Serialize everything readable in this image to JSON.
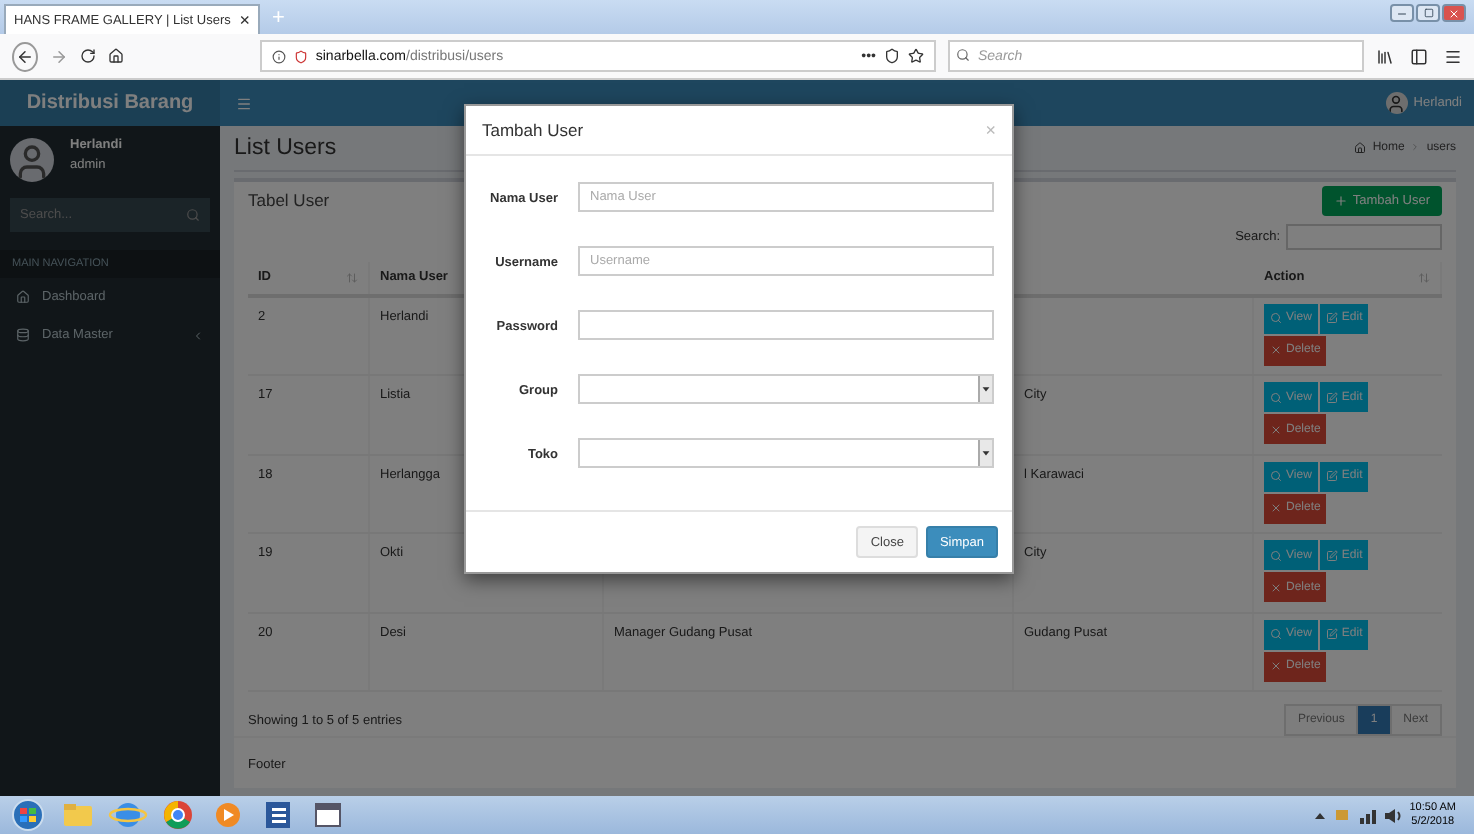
{
  "browser": {
    "tab": {
      "title": "HANS FRAME GALLERY | List Users",
      "close": "×"
    },
    "new_tab": "+",
    "url_host": "sinarbella.com",
    "url_path": "/distribusi/users",
    "page_actions": "•••",
    "search": {
      "placeholder": "Search"
    }
  },
  "header": {
    "brand": "Distribusi Barang",
    "user": "Herlandi"
  },
  "sidebar": {
    "user": {
      "name": "Herlandi",
      "role": "admin"
    },
    "search": {
      "placeholder": "Search..."
    },
    "section": "MAIN NAVIGATION",
    "items": [
      {
        "label": "Dashboard",
        "kind": "home",
        "expandable": false
      },
      {
        "label": "Data Master",
        "kind": "database",
        "expandable": true
      }
    ]
  },
  "content": {
    "title": "List Users",
    "breadcrumb": [
      "Home",
      "users"
    ],
    "box_title": "Tabel User",
    "add_button": "Tambah User",
    "search_label": "Search:",
    "columns": [
      "ID",
      "Nama User",
      "Action"
    ],
    "rows": [
      {
        "id": "2",
        "name": "Herlandi",
        "actions": [
          "View",
          "Edit",
          "Delete"
        ]
      },
      {
        "id": "17",
        "name": "Listia",
        "toko": "City",
        "actions": [
          "View",
          "Edit",
          "Delete"
        ]
      },
      {
        "id": "18",
        "name": "Herlangga",
        "toko": "l Karawaci",
        "actions": [
          "View",
          "Edit",
          "Delete"
        ]
      },
      {
        "id": "19",
        "name": "Okti",
        "toko": "City",
        "actions": [
          "View",
          "Edit",
          "Delete"
        ]
      },
      {
        "id": "20",
        "name": "Desi",
        "group": "Manager Gudang Pusat",
        "toko": "Gudang Pusat",
        "actions": [
          "View",
          "Edit",
          "Delete"
        ]
      }
    ],
    "info": "Showing 1 to 5 of 5 entries",
    "pagination": [
      {
        "label": "Previous",
        "selected": false
      },
      {
        "label": "1",
        "selected": true
      },
      {
        "label": "Next",
        "selected": false
      }
    ],
    "footer": "Footer"
  },
  "modal": {
    "title": "Tambah User",
    "close": "×",
    "fields": [
      {
        "label": "Nama User",
        "kind": "input",
        "placeholder": "Nama User"
      },
      {
        "label": "Username",
        "kind": "input",
        "placeholder": "Username"
      },
      {
        "label": "Password",
        "kind": "input"
      },
      {
        "label": "Group",
        "kind": "select"
      },
      {
        "label": "Toko",
        "kind": "select"
      }
    ],
    "buttons": [
      {
        "label": "Close",
        "kind": "default"
      },
      {
        "label": "Simpan",
        "kind": "primary"
      }
    ]
  },
  "taskbar": {
    "time": "10:50 AM",
    "date": "5/2/2018"
  }
}
